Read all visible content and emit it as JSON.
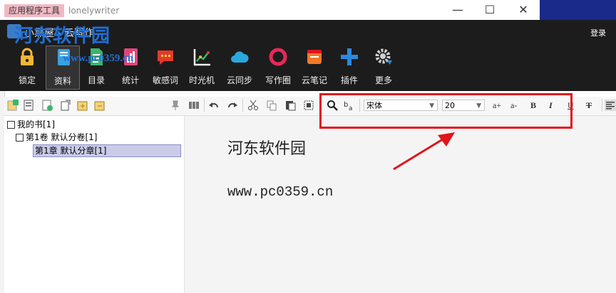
{
  "titlebar": {
    "tabs": [
      "应用程序工具",
      "lonelywriter"
    ],
    "minimize_icon": "minimize-icon",
    "maximize_icon": "maximize-icon",
    "close_icon": "close-icon"
  },
  "app": {
    "title": "小黑屋 - 云写作",
    "login": "登录"
  },
  "watermark": {
    "name": "河东软件园",
    "url": "www.pc0359.cn"
  },
  "ribbon": [
    {
      "label": "锁定",
      "icon": "lock-icon",
      "color": "#f2b632"
    },
    {
      "label": "资料",
      "icon": "book-icon",
      "color": "#3aa0e0",
      "active": true
    },
    {
      "label": "目录",
      "icon": "document-icon",
      "color": "#3bb56c"
    },
    {
      "label": "统计",
      "icon": "chart-icon",
      "color": "#e0457a"
    },
    {
      "label": "敏感词",
      "icon": "chat-warning-icon",
      "color": "#e23a2e"
    },
    {
      "label": "时光机",
      "icon": "timeline-chart-icon",
      "color": "#f0f0f0"
    },
    {
      "label": "云同步",
      "icon": "cloud-icon",
      "color": "#29a8e0"
    },
    {
      "label": "写作圈",
      "icon": "ring-icon",
      "color": "#e8285a"
    },
    {
      "label": "云笔记",
      "icon": "notebook-icon",
      "color": "#f07a2a"
    },
    {
      "label": "插件",
      "icon": "plus-icon",
      "color": "#2a8ae0"
    },
    {
      "label": "更多",
      "icon": "gear-icon",
      "color": "#cfcfcf"
    }
  ],
  "toolbar": {
    "font_name": "宋体",
    "font_size": "20",
    "bold": "B",
    "italic": "I",
    "underline": "U",
    "strike": "T",
    "grow": "a+",
    "shrink": "a-"
  },
  "tree": {
    "root": "我的书[1]",
    "volume": "第1卷 默认分卷[1]",
    "chapter": "第1章 默认分章[1]"
  },
  "editor": {
    "line1": "河东软件园",
    "line2": "www.pc0359.cn"
  },
  "colors": {
    "annotation": "#e0141b",
    "header_bg": "#1c1c1c"
  }
}
